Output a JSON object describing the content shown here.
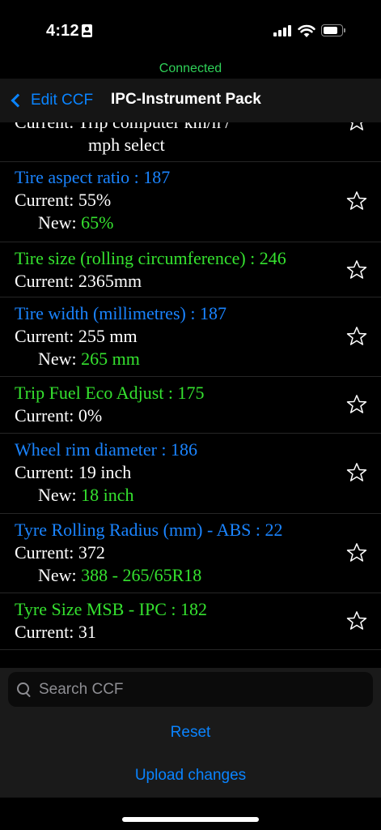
{
  "status_bar": {
    "time": "4:12"
  },
  "connection": {
    "status": "Connected",
    "color": "#2fd158"
  },
  "nav": {
    "back_label": "Edit CCF",
    "title": "IPC-Instrument Pack"
  },
  "colors": {
    "accent_blue": "#1a84ff",
    "value_green": "#35e22f"
  },
  "list": {
    "partial_top": {
      "line1": "Current: Trip computer km/h /",
      "line2": "mph select"
    },
    "items": [
      {
        "title": "Tire aspect ratio : 187",
        "title_color": "blue",
        "current_label": "Current:",
        "current_value": "55%",
        "new_label": "New:",
        "new_value": "65%"
      },
      {
        "title": "Tire size (rolling circumference) : 246",
        "title_color": "green",
        "current_label": "Current:",
        "current_value": "2365mm"
      },
      {
        "title": "Tire width (millimetres) : 187",
        "title_color": "blue",
        "current_label": "Current:",
        "current_value": "255 mm",
        "new_label": "New:",
        "new_value": "265 mm"
      },
      {
        "title": "Trip Fuel Eco Adjust : 175",
        "title_color": "green",
        "current_label": "Current:",
        "current_value": "0%"
      },
      {
        "title": "Wheel rim diameter : 186",
        "title_color": "blue",
        "current_label": "Current:",
        "current_value": "19 inch",
        "new_label": "New:",
        "new_value": "18 inch"
      },
      {
        "title": "Tyre Rolling Radius (mm) - ABS : 22",
        "title_color": "blue",
        "current_label": "Current:",
        "current_value": "372",
        "new_label": "New:",
        "new_value": "388 - 265/65R18"
      },
      {
        "title": "Tyre Size MSB - IPC : 182",
        "title_color": "green",
        "current_label": "Current:",
        "current_value": "31"
      }
    ]
  },
  "search": {
    "placeholder": "Search CCF",
    "value": ""
  },
  "actions": {
    "reset": "Reset",
    "upload": "Upload changes"
  }
}
